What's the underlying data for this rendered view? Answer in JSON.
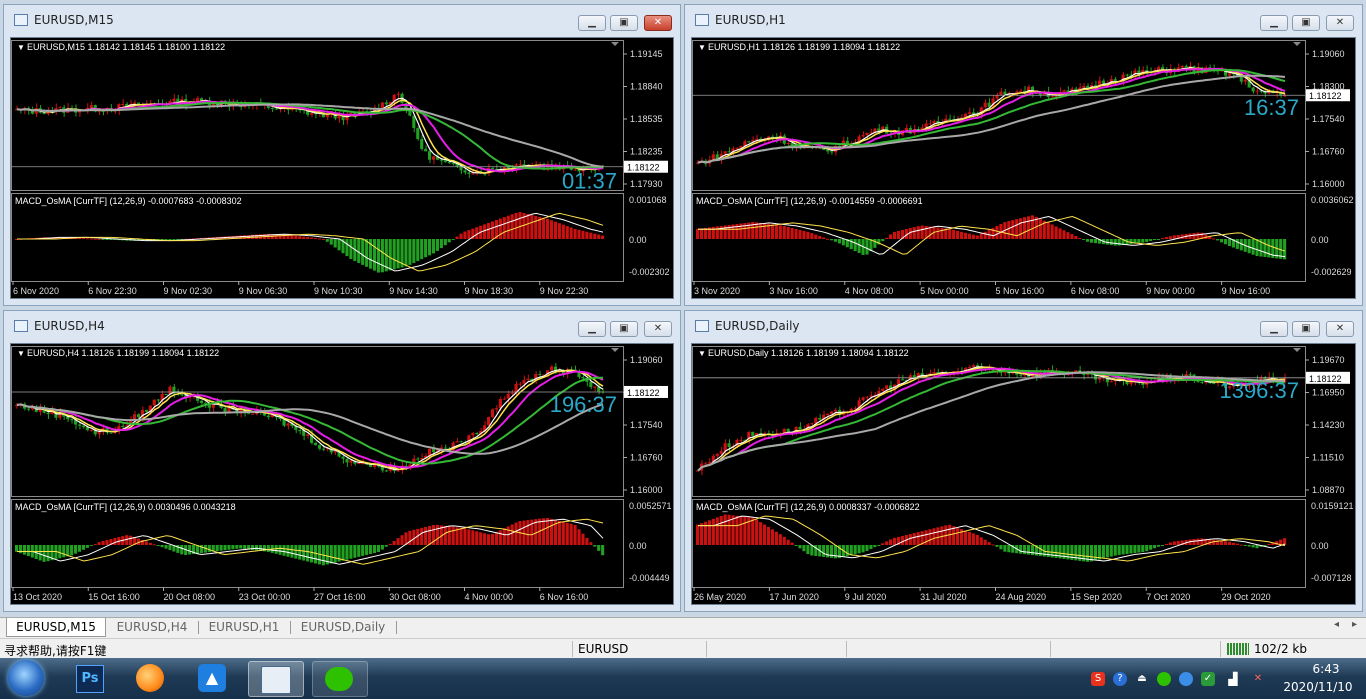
{
  "windows": [
    {
      "title": "EURUSD,M15",
      "header": "EURUSD,M15  1.18142 1.18145 1.18100 1.18122",
      "price_labels": [
        "1.19145",
        "1.18840",
        "1.18535",
        "1.18235",
        "1.17930"
      ],
      "current_price": "1.18122",
      "timer": "01:37",
      "macd_header": "MACD_OsMA [CurrTF] (12,26,9) -0.0007683 -0.0008302",
      "macd_labels": [
        "0.001068",
        "0.00",
        "-0.002302"
      ],
      "time_labels": [
        "6 Nov 2020",
        "6 Nov 22:30",
        "9 Nov 02:30",
        "9 Nov 06:30",
        "9 Nov 10:30",
        "9 Nov 14:30",
        "9 Nov 18:30",
        "9 Nov 22:30"
      ],
      "close_active": true
    },
    {
      "title": "EURUSD,H1",
      "header": "EURUSD,H1  1.18126 1.18199 1.18094 1.18122",
      "price_labels": [
        "1.19060",
        "1.18300",
        "1.17540",
        "1.16760",
        "1.16000"
      ],
      "current_price": "1.18122",
      "timer": "16:37",
      "macd_header": "MACD_OsMA [CurrTF] (12,26,9) -0.0014559 -0.0006691",
      "macd_labels": [
        "0.0036062",
        "0.00",
        "-0.002629"
      ],
      "time_labels": [
        "3 Nov 2020",
        "3 Nov 16:00",
        "4 Nov 08:00",
        "5 Nov 00:00",
        "5 Nov 16:00",
        "6 Nov 08:00",
        "9 Nov 00:00",
        "9 Nov 16:00"
      ],
      "close_active": false
    },
    {
      "title": "EURUSD,H4",
      "header": "EURUSD,H4  1.18126 1.18199 1.18094 1.18122",
      "price_labels": [
        "1.19060",
        "1.18300",
        "1.17540",
        "1.16760",
        "1.16000"
      ],
      "current_price": "1.18122",
      "timer": "196:37",
      "macd_header": "MACD_OsMA [CurrTF] (12,26,9) 0.0030496 0.0043218",
      "macd_labels": [
        "0.0052571",
        "0.00",
        "-0.004449"
      ],
      "time_labels": [
        "13 Oct 2020",
        "15 Oct 16:00",
        "20 Oct 08:00",
        "23 Oct 00:00",
        "27 Oct 16:00",
        "30 Oct 08:00",
        "4 Nov 00:00",
        "6 Nov 16:00"
      ],
      "close_active": false
    },
    {
      "title": "EURUSD,Daily",
      "header": "EURUSD,Daily  1.18126 1.18199 1.18094 1.18122",
      "price_labels": [
        "1.19670",
        "1.16950",
        "1.14230",
        "1.11510",
        "1.08870"
      ],
      "current_price": "1.18122",
      "timer": "1396:37",
      "macd_header": "MACD_OsMA [CurrTF] (12,26,9) 0.0008337 -0.0006822",
      "macd_labels": [
        "0.0159121",
        "0.00",
        "-0.007128"
      ],
      "time_labels": [
        "26 May 2020",
        "17 Jun 2020",
        "9 Jul 2020",
        "31 Jul 2020",
        "24 Aug 2020",
        "15 Sep 2020",
        "7 Oct 2020",
        "29 Oct 2020"
      ],
      "close_active": false
    }
  ],
  "tabs": [
    "EURUSD,M15",
    "EURUSD,H4",
    "EURUSD,H1",
    "EURUSD,Daily"
  ],
  "status": {
    "help": "寻求帮助,请按F1键",
    "symbol": "EURUSD",
    "traffic": "102/2 kb"
  },
  "clock": {
    "time": "6:43",
    "date": "2020/11/10"
  },
  "taskbar_apps": [
    "start-orb",
    "photoshop",
    "firefox-like",
    "app-blue",
    "metatrader",
    "wechat"
  ],
  "colors": {
    "bull": "#cc1111",
    "bear": "#22a022",
    "timer": "#2aa9c9",
    "ma_yellow": "#ffe34d",
    "ma_magenta": "#e51ee5",
    "ma_green": "#35b835",
    "ma_gray": "#a8a8a8"
  }
}
